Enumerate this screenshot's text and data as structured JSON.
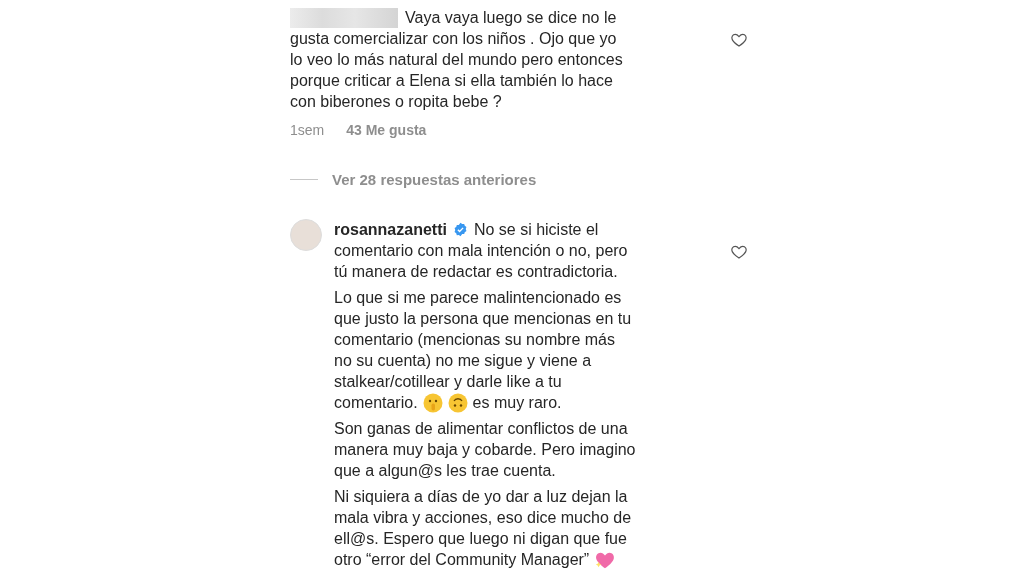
{
  "comments": [
    {
      "username_redacted": true,
      "paragraphs": [
        {
          "lines": [
            "Vaya vaya luego se dice no le",
            "gusta comercializar con los niños . Ojo que yo",
            "lo veo lo más natural del mundo pero entonces",
            "porque criticar a Elena si ella también lo hace",
            "con biberones o ropita bebe ?"
          ]
        }
      ],
      "time": "1sem",
      "likes": "43 Me gusta",
      "liked": false
    },
    {
      "username": "rosannazanetti",
      "verified": true,
      "paragraphs": [
        {
          "lines": [
            "No se si hiciste el",
            "comentario con mala intención o no, pero",
            "tú manera de redactar es contradictoria."
          ]
        },
        {
          "lines": [
            "Lo que si me parece malintencionado es",
            "que justo la persona que mencionas en tu",
            "comentario (mencionas su nombre más",
            "no su cuenta) no me sigue y viene a",
            "stalkear/cotillear y darle like a tu",
            "comentario."
          ],
          "after_icons": "es muy raro."
        },
        {
          "lines": [
            "Son ganas de alimentar conflictos de una",
            "manera muy baja y cobarde. Pero imagino",
            "que a algun@s les trae cuenta."
          ]
        },
        {
          "lines": [
            "Ni siquiera a días de yo dar a luz dejan la",
            "mala vibra y acciones, eso dice mucho de",
            "ell@s. Espero que luego ni digan que fue",
            "otro “error del Community Manager”"
          ],
          "heart_icon": true
        }
      ],
      "liked": false
    }
  ],
  "view_replies": "Ver 28 respuestas anteriores"
}
